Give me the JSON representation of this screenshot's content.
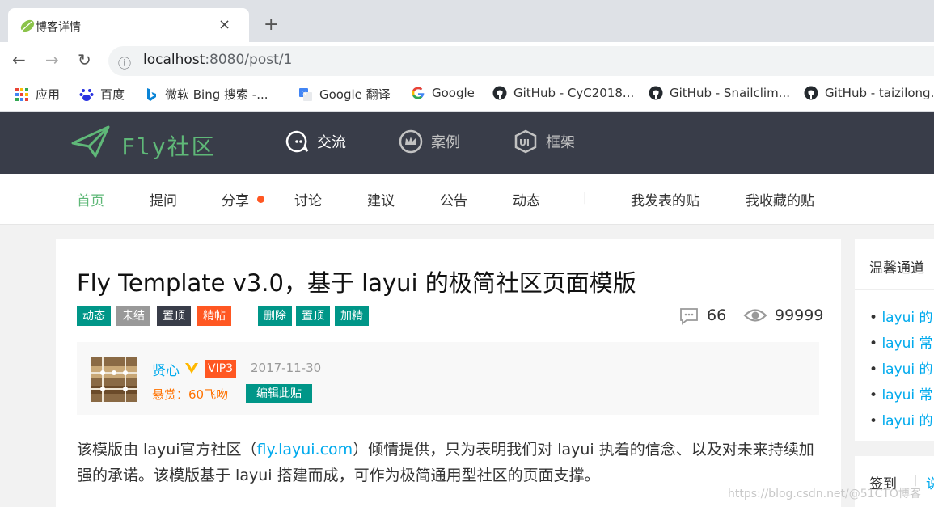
{
  "browser": {
    "tab_title": "博客详情",
    "tab_close": "×",
    "new_tab": "+",
    "url_host": "localhost",
    "url_rest": ":8080/post/1",
    "back": "←",
    "forward": "→",
    "reload": "↻",
    "info": "ⓘ",
    "bookmarks": [
      {
        "label": "应用",
        "icon": "apps-grid-icon"
      },
      {
        "label": "百度",
        "icon": "baidu-paw-icon"
      },
      {
        "label": "微软 Bing 搜索 -...",
        "icon": "bing-icon"
      },
      {
        "label": "Google 翻译",
        "icon": "google-translate-icon"
      },
      {
        "label": "Google",
        "icon": "google-icon"
      },
      {
        "label": "GitHub - CyC2018...",
        "icon": "github-icon"
      },
      {
        "label": "GitHub - Snailclim...",
        "icon": "github-icon"
      },
      {
        "label": "GitHub - taizilong...",
        "icon": "github-icon"
      }
    ]
  },
  "site": {
    "logo": "Fly社区",
    "nav": [
      {
        "label": "交流",
        "icon": "chat-bubble-icon",
        "active": true
      },
      {
        "label": "案例",
        "icon": "crown-icon",
        "active": false
      },
      {
        "label": "框架",
        "icon": "ui-shield-icon",
        "active": false
      }
    ],
    "subnav": [
      "首页",
      "提问",
      "分享",
      "讨论",
      "建议",
      "公告",
      "动态",
      "我发表的贴",
      "我收藏的贴"
    ],
    "subnav_sep": "|"
  },
  "post": {
    "title": "Fly Template v3.0，基于 layui 的极简社区页面模版",
    "badges": [
      {
        "label": "动态",
        "color": "#009688"
      },
      {
        "label": "未结",
        "color": "#999999"
      },
      {
        "label": "置顶",
        "color": "#393d49"
      },
      {
        "label": "精帖",
        "color": "#ff5722"
      }
    ],
    "admin_badges": [
      {
        "label": "删除",
        "color": "#009688"
      },
      {
        "label": "置顶",
        "color": "#009688"
      },
      {
        "label": "加精",
        "color": "#009688"
      }
    ],
    "comments": "66",
    "views": "99999",
    "author": "贤心",
    "vip": "VIP3",
    "date": "2017-11-30",
    "reward": "悬赏：60飞吻",
    "edit_button": "编辑此贴",
    "body_before": "该模版由 layui官方社区（",
    "body_link": "fly.layui.com",
    "body_after": "）倾情提供，只为表明我们对 layui 执着的信念、以及对未来持续加强的承诺。该模版基于 layui 搭建而成，可作为极简通用型社区的页面支撑。"
  },
  "sidebar": {
    "title": "温馨通道",
    "items": [
      "layui 的",
      "layui 常",
      "layui 的",
      "layui 常",
      "layui 的"
    ],
    "signin_label": "签到",
    "signin_more": "说"
  },
  "watermark": "https://blog.csdn.net/@51CTO博客",
  "colors": {
    "header_bg": "#393d49",
    "accent": "#5fb878",
    "link": "#01aaed",
    "hot": "#ff5722"
  }
}
